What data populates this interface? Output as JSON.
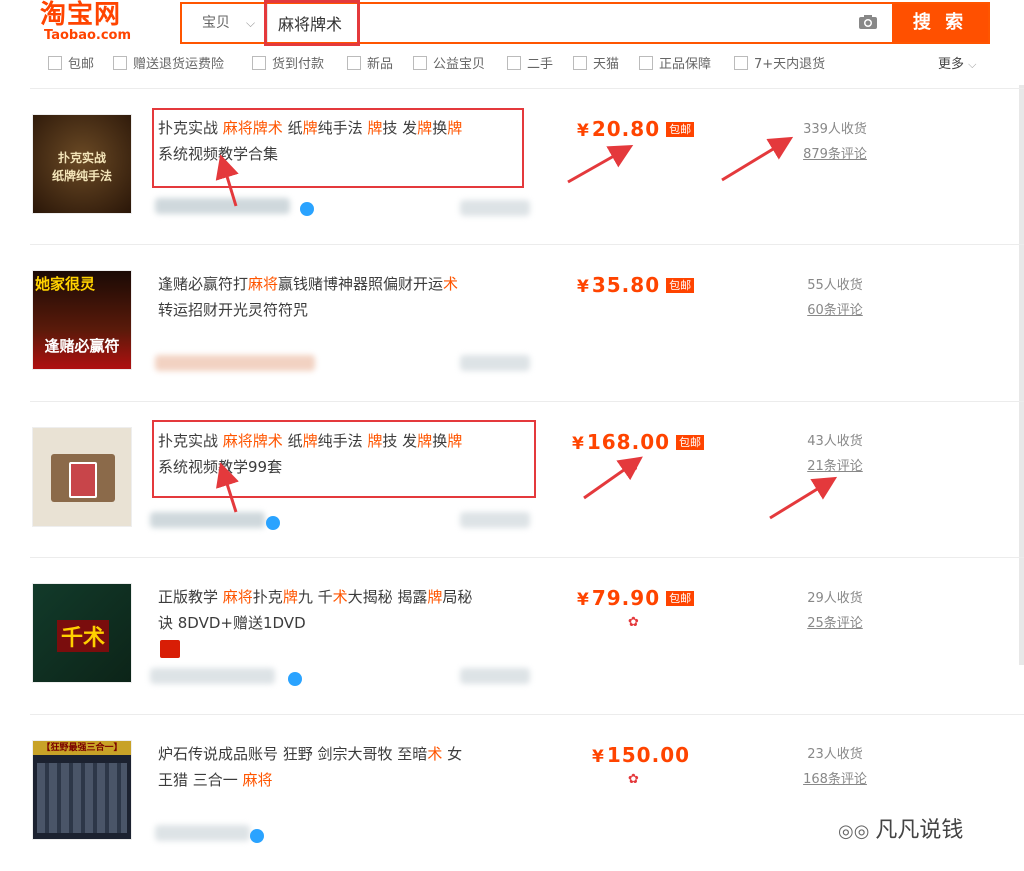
{
  "header": {
    "logo_cn": "淘宝网",
    "logo_en": "Taobao.com",
    "scope": "宝贝",
    "search_value": "麻将牌术",
    "search_button": "搜 索"
  },
  "filters": [
    "包邮",
    "赠送退货运费险",
    "货到付款",
    "新品",
    "公益宝贝",
    "二手",
    "天猫",
    "正品保障",
    "7+天内退货"
  ],
  "more_label": "更多",
  "items": [
    {
      "title_parts": [
        "扑克实战 ",
        "麻将牌术",
        " 纸",
        "牌",
        "纯手法 ",
        "牌",
        "技 发",
        "牌",
        "换",
        "牌"
      ],
      "title_line2": "系统视频教学合集",
      "thumb_line1": "扑克实战",
      "thumb_line2": "纸牌纯手法",
      "price": "20.80",
      "badge": "包邮",
      "sales": "339人收货",
      "reviews": "879条评论"
    },
    {
      "title_parts": [
        "逢赌必赢符打",
        "麻将",
        "赢钱赌博神器照偏财开运",
        "术"
      ],
      "title_line2": "转运招财开光灵符符咒",
      "thumb_line1": "她家很灵",
      "thumb_line2": "逢赌必赢符",
      "price": "35.80",
      "badge": "包邮",
      "sales": "55人收货",
      "reviews": "60条评论"
    },
    {
      "title_parts": [
        "扑克实战 ",
        "麻将牌术",
        " 纸",
        "牌",
        "纯手法 ",
        "牌",
        "技 发",
        "牌",
        "换",
        "牌"
      ],
      "title_line2": "系统视频教学99套",
      "price": "168.00",
      "badge": "包邮",
      "sales": "43人收货",
      "reviews": "21条评论"
    },
    {
      "title_parts": [
        "正版教学 ",
        "麻将",
        "扑克",
        "牌",
        "九 千",
        "术",
        "大揭秘 揭露",
        "牌",
        "局秘"
      ],
      "title_line2": "诀 8DVD+赠送1DVD",
      "thumb_line1": "千术",
      "price": "79.90",
      "badge": "包邮",
      "sales": "29人收货",
      "reviews": "25条评论"
    },
    {
      "title_parts": [
        "炉石传说成品账号 狂野 剑宗大哥牧 至暗",
        "术",
        " 女"
      ],
      "title_line2_parts": [
        "王猎 三合一 ",
        "麻将"
      ],
      "thumb_line1": "【狂野最强三合一】",
      "price": "150.00",
      "sales": "23人收货",
      "reviews": "168条评论"
    }
  ],
  "watermark": "凡凡说钱",
  "colors": {
    "brand": "#ff5000",
    "price": "#ff4400",
    "annotation": "#e4393c"
  }
}
